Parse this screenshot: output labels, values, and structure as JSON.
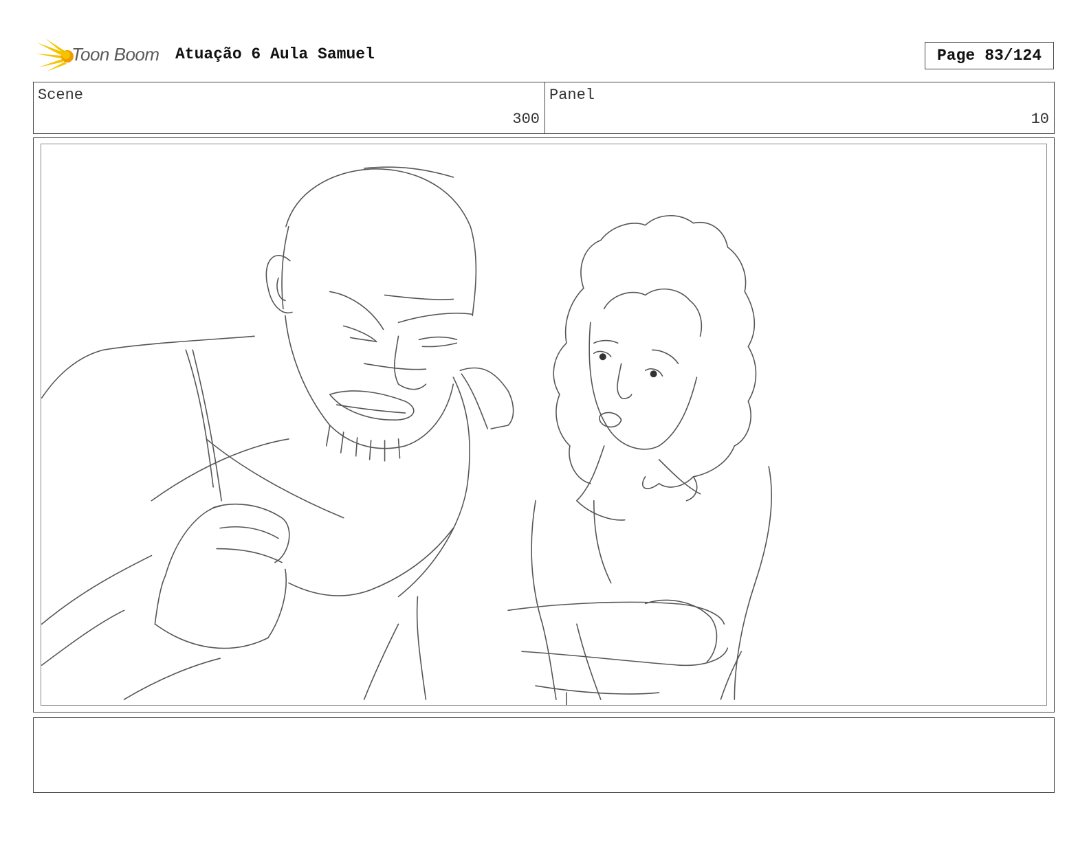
{
  "header": {
    "logo_text": "Toon Boom",
    "title": "Atuação 6 Aula Samuel",
    "page_label": "Page",
    "page_number": "83/124"
  },
  "scene": {
    "label": "Scene",
    "value": "300"
  },
  "panel": {
    "label": "Panel",
    "value": "10"
  },
  "notes": {
    "text": ""
  },
  "colors": {
    "logo_yellow": "#f5c400",
    "logo_orange": "#f29a00",
    "sketch_line": "#555555",
    "border": "#444444"
  },
  "icons": {
    "logo": "toon-boom-burst-icon"
  }
}
